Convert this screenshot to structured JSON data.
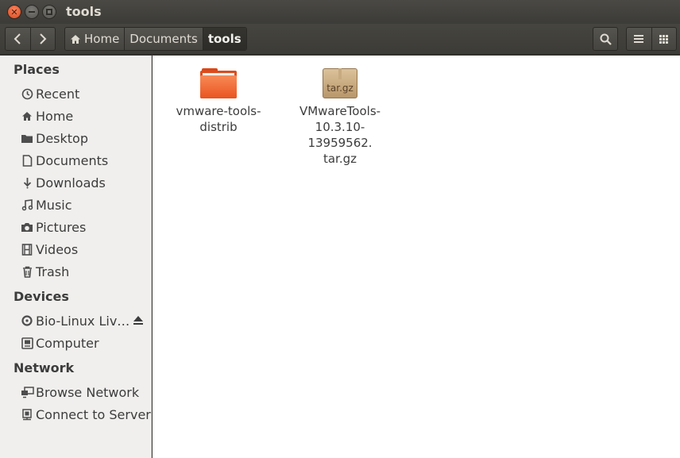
{
  "window": {
    "title": "tools"
  },
  "toolbar": {
    "back_icon": "chevron-left-icon",
    "forward_icon": "chevron-right-icon",
    "breadcrumbs": [
      "Home",
      "Documents",
      "tools"
    ],
    "search_icon": "search-icon",
    "list_view_icon": "list-view-icon",
    "grid_view_icon": "grid-view-icon"
  },
  "sidebar": {
    "places_header": "Places",
    "places": [
      {
        "label": "Recent",
        "icon": "clock-icon"
      },
      {
        "label": "Home",
        "icon": "home-icon"
      },
      {
        "label": "Desktop",
        "icon": "folder-icon"
      },
      {
        "label": "Documents",
        "icon": "document-icon"
      },
      {
        "label": "Downloads",
        "icon": "download-icon"
      },
      {
        "label": "Music",
        "icon": "music-icon"
      },
      {
        "label": "Pictures",
        "icon": "camera-icon"
      },
      {
        "label": "Videos",
        "icon": "film-icon"
      },
      {
        "label": "Trash",
        "icon": "trash-icon"
      }
    ],
    "devices_header": "Devices",
    "devices": [
      {
        "label": "Bio-Linux Liv…",
        "icon": "disc-icon"
      },
      {
        "label": "Computer",
        "icon": "computer-icon"
      }
    ],
    "network_header": "Network",
    "network": [
      {
        "label": "Browse Network",
        "icon": "network-icon"
      },
      {
        "label": "Connect to Server",
        "icon": "server-icon"
      }
    ]
  },
  "files": [
    {
      "name": "vmware-tools-\ndistrib",
      "type": "folder"
    },
    {
      "name": "VMwareTools-\n10.3.10-13959562.\ntar.gz",
      "type": "archive",
      "badge": "tar.gz"
    }
  ],
  "colors": {
    "folder": "#e9541f",
    "titlebar": "#3c3b37",
    "sidebar": "#f0efed",
    "close": "#e0491c"
  }
}
